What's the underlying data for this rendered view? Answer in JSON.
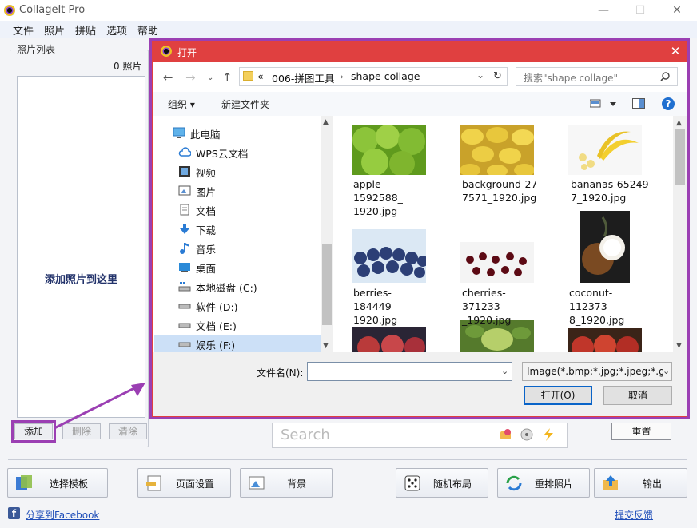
{
  "app": {
    "title": "CollageIt Pro",
    "menu": [
      "文件",
      "照片",
      "拼贴",
      "选项",
      "帮助"
    ]
  },
  "photo_panel": {
    "label": "照片列表",
    "count": "0 照片",
    "drop_hint": "添加照片到这里",
    "add": "添加",
    "remove": "删除",
    "clear": "清除"
  },
  "search": {
    "placeholder": "Search"
  },
  "reset": "重置",
  "bottom_buttons": [
    {
      "label": "选择模板",
      "icon": "template-icon"
    },
    {
      "label": "页面设置",
      "icon": "page-setup-icon"
    },
    {
      "label": "背景",
      "icon": "background-icon"
    },
    {
      "label": "随机布局",
      "icon": "dice-icon"
    },
    {
      "label": "重排照片",
      "icon": "shuffle-icon"
    },
    {
      "label": "输出",
      "icon": "export-icon"
    }
  ],
  "footer": {
    "share": "分享到Facebook",
    "feedback": "提交反馈"
  },
  "dialog": {
    "title": "打开",
    "breadcrumb": [
      "«",
      "006-拼图工具",
      "›",
      "shape collage"
    ],
    "search_placeholder": "搜索\"shape collage\"",
    "toolbar": {
      "organize": "组织 ▾",
      "new_folder": "新建文件夹"
    },
    "nav": [
      {
        "label": "此电脑",
        "icon": "pc-icon"
      },
      {
        "label": "WPS云文档",
        "icon": "cloud-icon"
      },
      {
        "label": "视频",
        "icon": "video-icon"
      },
      {
        "label": "图片",
        "icon": "pictures-icon"
      },
      {
        "label": "文档",
        "icon": "documents-icon"
      },
      {
        "label": "下载",
        "icon": "download-icon"
      },
      {
        "label": "音乐",
        "icon": "music-icon"
      },
      {
        "label": "桌面",
        "icon": "desktop-icon"
      },
      {
        "label": "本地磁盘 (C:)",
        "icon": "drive-icon"
      },
      {
        "label": "软件 (D:)",
        "icon": "drive-icon"
      },
      {
        "label": "文档 (E:)",
        "icon": "drive-icon"
      },
      {
        "label": "娱乐 (F:)",
        "icon": "drive-icon"
      }
    ],
    "files": [
      {
        "line1": "apple-1592588_",
        "line2": "1920.jpg"
      },
      {
        "line1": "background-27",
        "line2": "7571_1920.jpg"
      },
      {
        "line1": "bananas-65249",
        "line2": "7_1920.jpg"
      },
      {
        "line1": "berries-184449_",
        "line2": "1920.jpg"
      },
      {
        "line1": "cherries-371233",
        "line2": "_1920.jpg"
      },
      {
        "line1": "coconut-112373",
        "line2": "8_1920.jpg"
      }
    ],
    "filename_label": "文件名(N):",
    "filename_value": "",
    "filetype": "Image(*.bmp;*.jpg;*.jpeg;*.gi",
    "open": "打开(O)",
    "cancel": "取消"
  },
  "colors": {
    "dialog_title": "#e04040",
    "highlight": "#9b3fb3",
    "link": "#1e4db8"
  }
}
